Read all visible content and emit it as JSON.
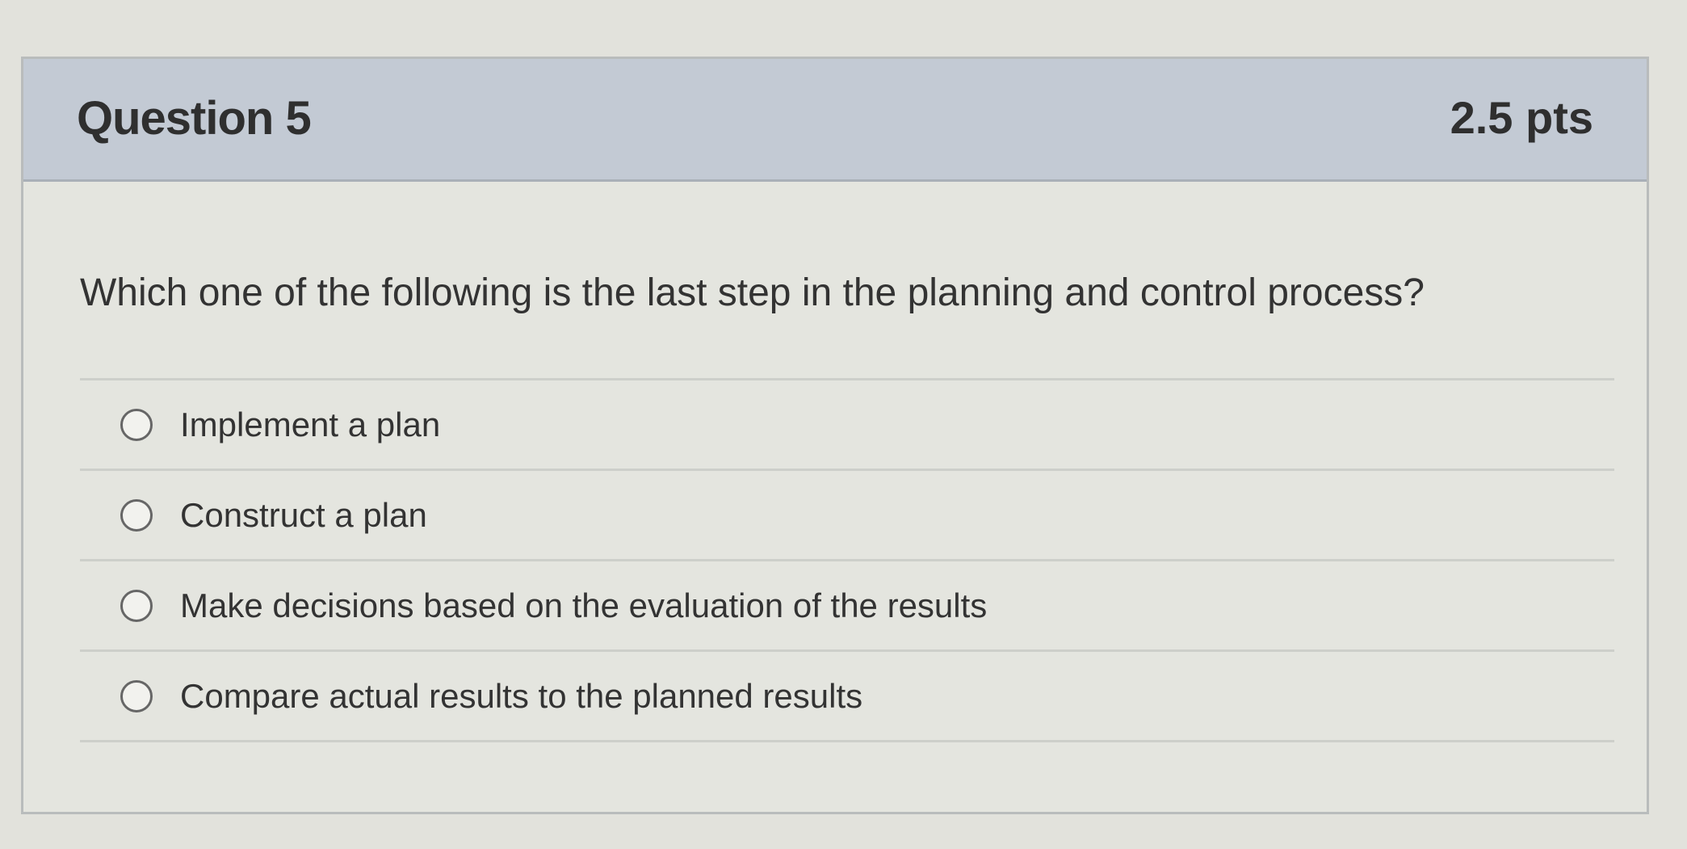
{
  "question": {
    "title": "Question 5",
    "points": "2.5 pts",
    "prompt": "Which one of the following is the last step in the planning and control process?"
  },
  "answers": [
    {
      "label": "Implement a plan"
    },
    {
      "label": "Construct a plan"
    },
    {
      "label": "Make decisions based on the evaluation of the results"
    },
    {
      "label": "Compare actual results to the planned results"
    }
  ],
  "colors": {
    "header_background": "#c3cad4",
    "card_background": "#e4e5df",
    "text": "#333333"
  }
}
